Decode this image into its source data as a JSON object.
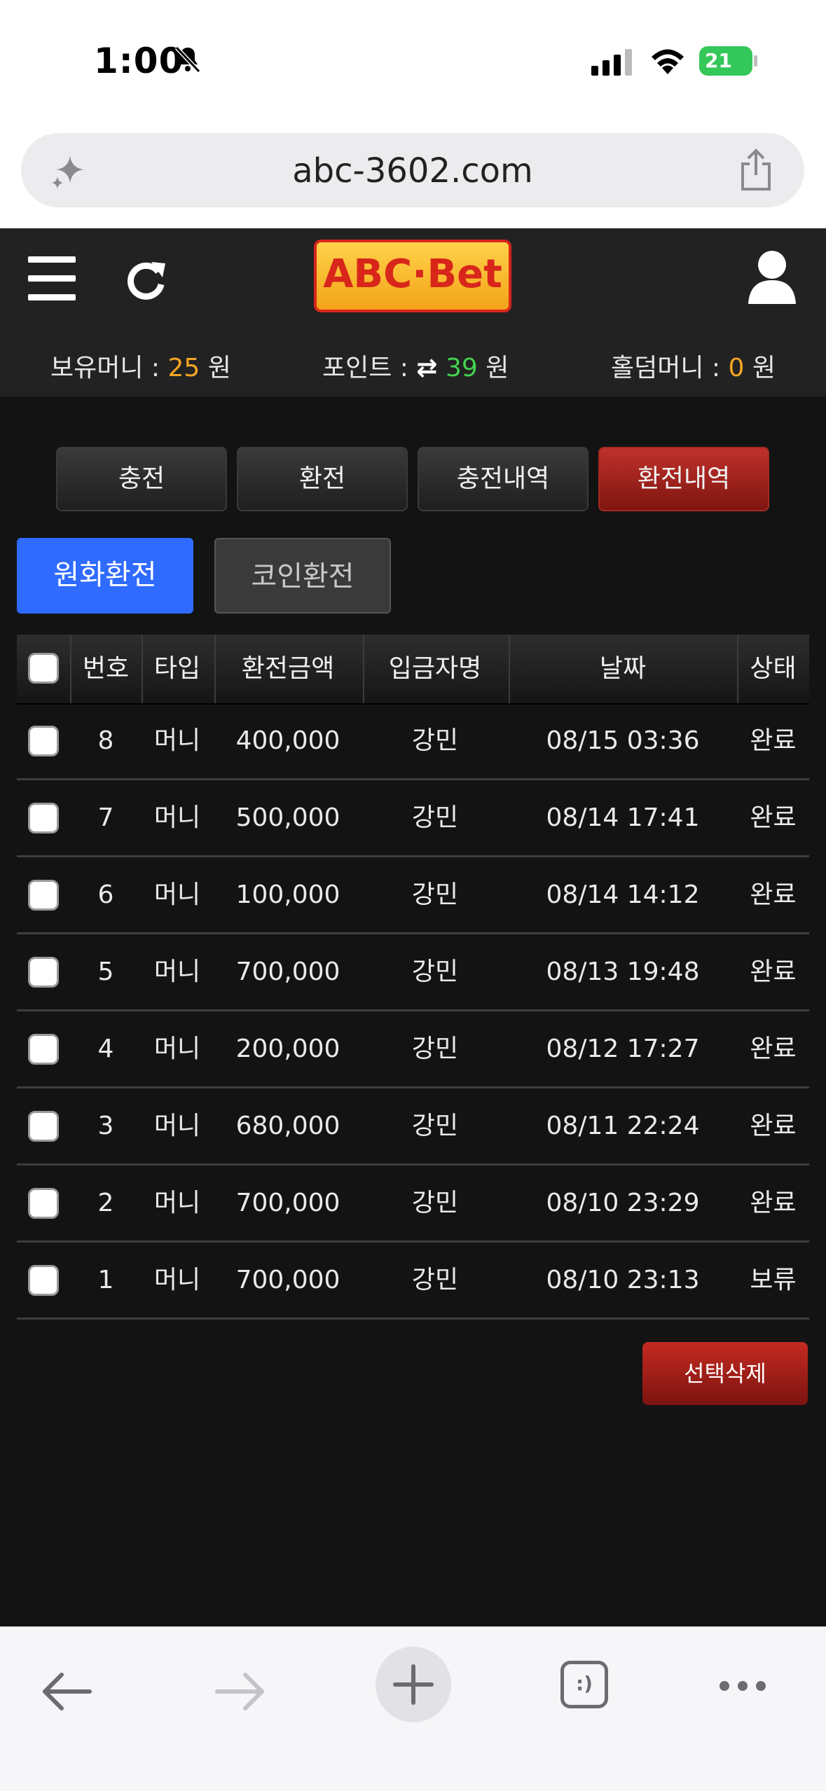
{
  "status_bar": {
    "time": "1:00",
    "battery": "21"
  },
  "browser": {
    "url": "abc-3602.com"
  },
  "site": {
    "logo": "ABC·Bet",
    "balance": {
      "label": "보유머니 : ",
      "value": "25",
      "unit": " 원"
    },
    "points": {
      "label": "포인트 : ",
      "icon": "⇄",
      "value": "39",
      "unit": " 원"
    },
    "holdem": {
      "label": "홀덤머니 : ",
      "value": "0",
      "unit": " 원"
    }
  },
  "tabs": [
    {
      "label": "충전"
    },
    {
      "label": "환전"
    },
    {
      "label": "충전내역"
    },
    {
      "label": "환전내역"
    }
  ],
  "sub_tabs": {
    "krw": "원화환전",
    "coin": "코인환전"
  },
  "table": {
    "headers": [
      "번호",
      "타입",
      "환전금액",
      "입금자명",
      "날짜",
      "상태"
    ],
    "rows": [
      {
        "no": "8",
        "type": "머니",
        "amount": "400,000",
        "name": "강민",
        "date": "08/15 03:36",
        "status": "완료"
      },
      {
        "no": "7",
        "type": "머니",
        "amount": "500,000",
        "name": "강민",
        "date": "08/14 17:41",
        "status": "완료"
      },
      {
        "no": "6",
        "type": "머니",
        "amount": "100,000",
        "name": "강민",
        "date": "08/14 14:12",
        "status": "완료"
      },
      {
        "no": "5",
        "type": "머니",
        "amount": "700,000",
        "name": "강민",
        "date": "08/13 19:48",
        "status": "완료"
      },
      {
        "no": "4",
        "type": "머니",
        "amount": "200,000",
        "name": "강민",
        "date": "08/12 17:27",
        "status": "완료"
      },
      {
        "no": "3",
        "type": "머니",
        "amount": "680,000",
        "name": "강민",
        "date": "08/11 22:24",
        "status": "완료"
      },
      {
        "no": "2",
        "type": "머니",
        "amount": "700,000",
        "name": "강민",
        "date": "08/10 23:29",
        "status": "완료"
      },
      {
        "no": "1",
        "type": "머니",
        "amount": "700,000",
        "name": "강민",
        "date": "08/10 23:13",
        "status": "보류"
      }
    ]
  },
  "actions": {
    "delete_selected": "선택삭제"
  },
  "toolbar": {
    "tabs_icon_text": ":)"
  },
  "colors": {
    "accent_blue": "#2f6bff",
    "active_tab_red": "#a32a22",
    "orange": "#f5a623",
    "green": "#44d14f"
  }
}
